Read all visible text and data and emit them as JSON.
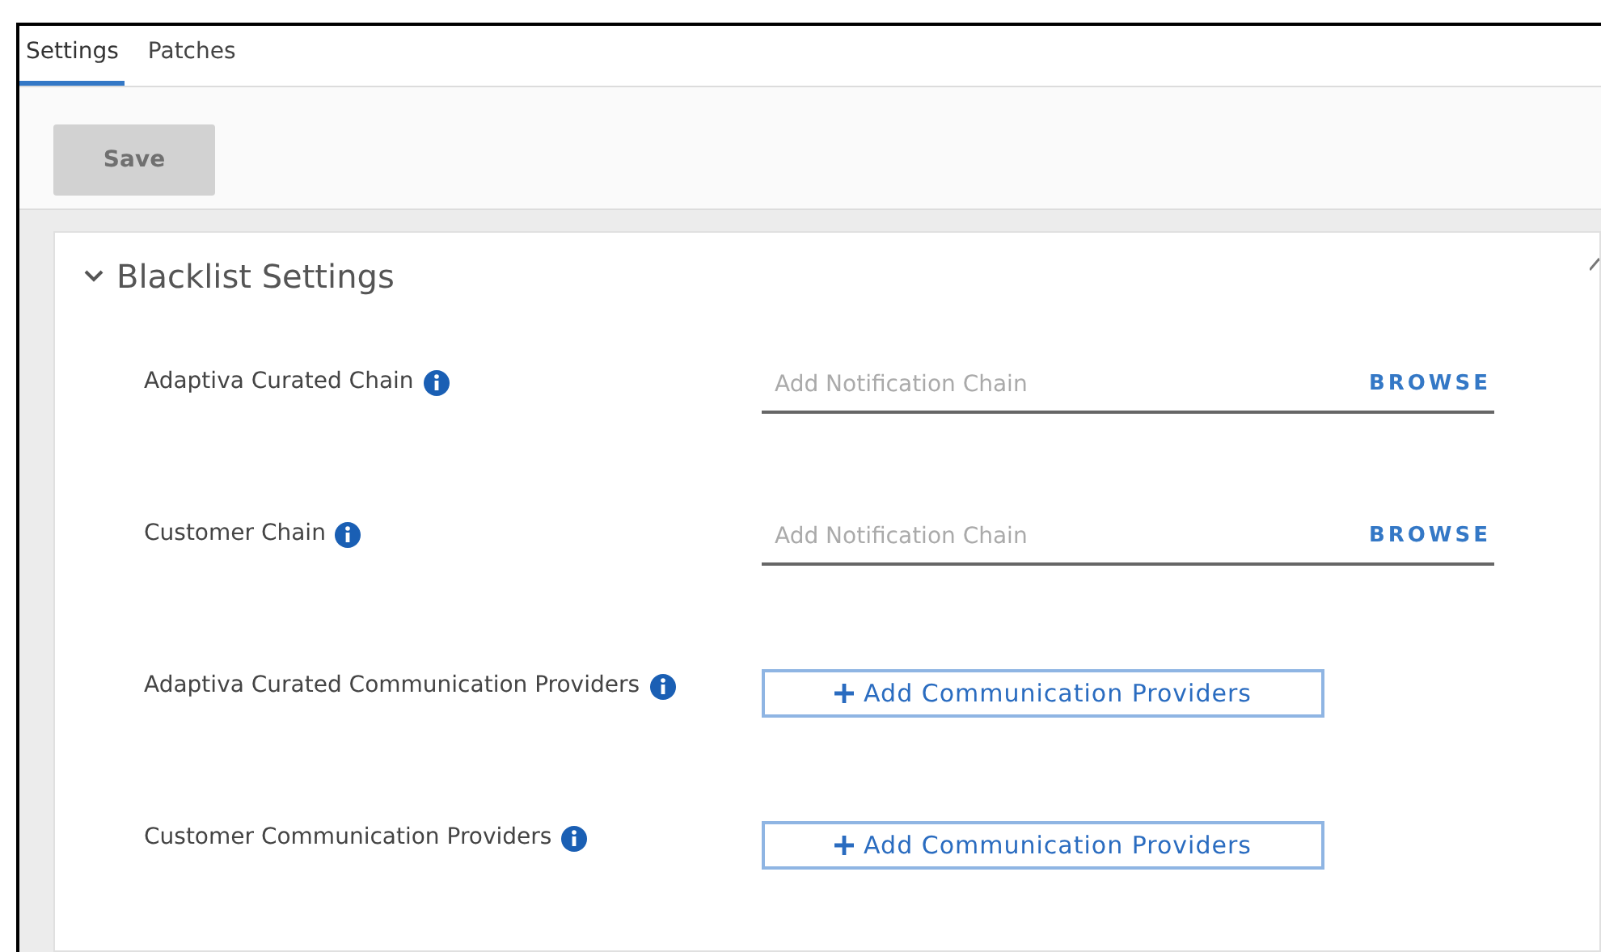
{
  "tabs": [
    {
      "label": "Settings",
      "selected": true
    },
    {
      "label": "Patches",
      "selected": false
    }
  ],
  "toolbar": {
    "save_button": {
      "label": "Save",
      "disabled": true
    }
  },
  "section": {
    "title": "Blacklist Settings",
    "expanded": true,
    "rows": [
      {
        "kind": "chain",
        "label": "Adaptiva Curated Chain",
        "placeholder": "Add Notification Chain",
        "action": "BROWSE"
      },
      {
        "kind": "chain",
        "label": "Customer Chain",
        "placeholder": "Add Notification Chain",
        "action": "BROWSE"
      },
      {
        "kind": "providers",
        "label": "Adaptiva Curated Communication Providers",
        "button": "Add Communication Providers"
      },
      {
        "kind": "providers",
        "label": "Customer Communication Providers",
        "button": "Add Communication Providers"
      }
    ]
  }
}
